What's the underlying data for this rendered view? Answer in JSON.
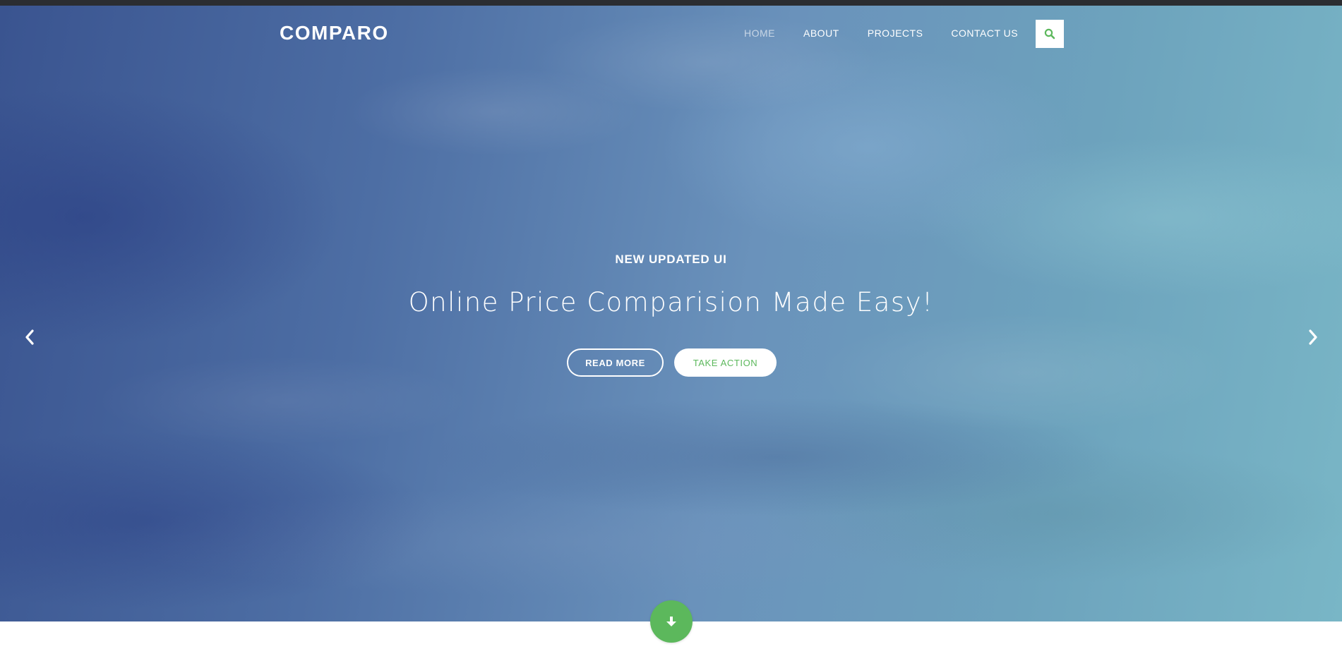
{
  "brand": {
    "name": "COMPARO"
  },
  "nav": {
    "items": [
      {
        "label": "HOME",
        "active": true
      },
      {
        "label": "ABOUT",
        "active": false
      },
      {
        "label": "PROJECTS",
        "active": false
      },
      {
        "label": "CONTACT US",
        "active": false
      }
    ],
    "search_icon": "search-icon"
  },
  "hero": {
    "subtitle": "NEW UPDATED UI",
    "headline": "Online Price Comparision Made Easy!",
    "primary_button": "READ MORE",
    "secondary_button": "TAKE ACTION",
    "prev_icon": "chevron-left-icon",
    "next_icon": "chevron-right-icon",
    "scroll_icon": "arrow-down-icon"
  },
  "colors": {
    "accent": "#5cb85c",
    "topbar": "#2b2d31",
    "text": "#ffffff"
  }
}
